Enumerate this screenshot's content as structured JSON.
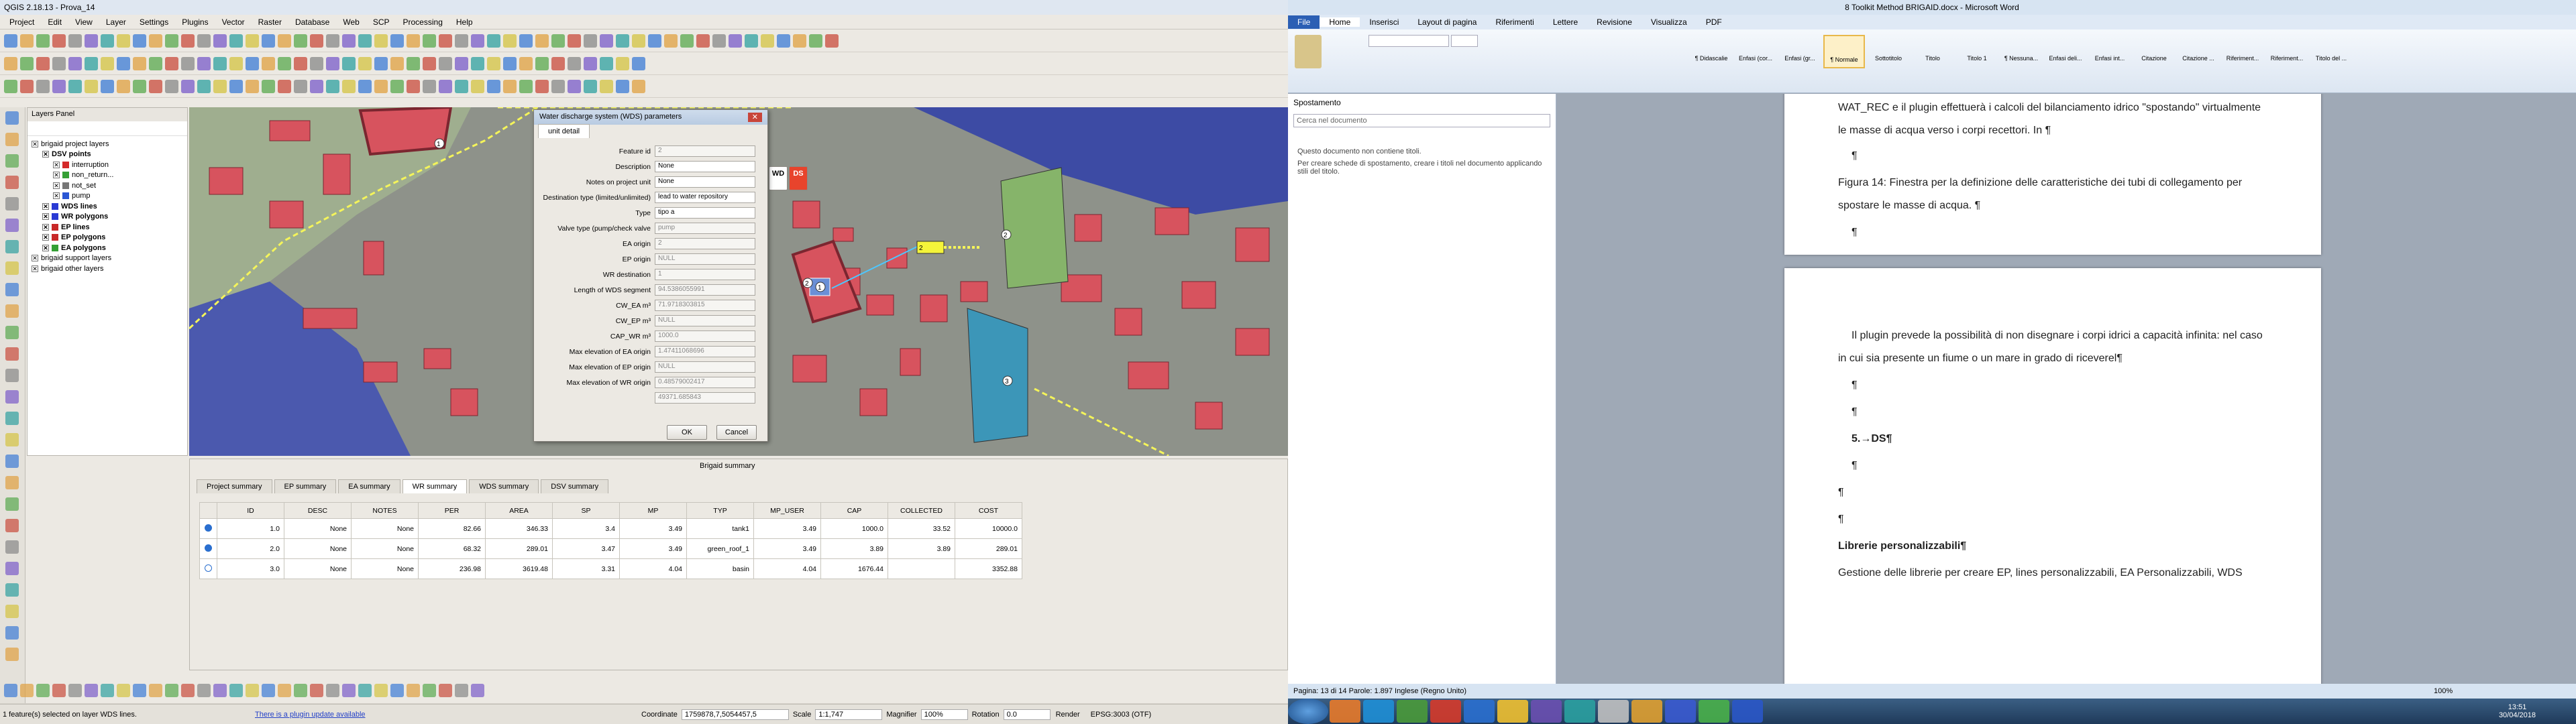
{
  "qgis": {
    "title": "QGIS 2.18.13 - Prova_14",
    "menu": [
      "Project",
      "Edit",
      "View",
      "Layer",
      "Settings",
      "Plugins",
      "Vector",
      "Raster",
      "Database",
      "Web",
      "SCP",
      "Processing",
      "Help"
    ],
    "layers_panel_title": "Layers Panel",
    "layers": [
      "brigaid project layers",
      "DSV points",
      "interruption",
      "non_return...",
      "not_set",
      "pump",
      "WDS lines",
      "WR polygons",
      "EP lines",
      "EP polygons",
      "EA polygons",
      "brigaid support layers",
      "brigaid other layers"
    ],
    "map_labels": [
      "1",
      "2",
      "3",
      "2",
      "1",
      "2"
    ],
    "map_buttons": [
      "WD",
      "DS"
    ],
    "dialog": {
      "title": "Water discharge system (WDS) parameters",
      "tab": "unit detail",
      "fields": [
        {
          "label": "Feature id",
          "value": "2"
        },
        {
          "label": "Description",
          "value": "None"
        },
        {
          "label": "Notes on project unit",
          "value": "None"
        },
        {
          "label": "Destination type (limited/unlimited)",
          "value": "lead to water repository"
        },
        {
          "label": "Type",
          "value": "tipo a"
        },
        {
          "label": "Valve type (pump/check valve",
          "value": "pump"
        },
        {
          "label": "EA origin",
          "value": "2"
        },
        {
          "label": "EP origin",
          "value": "NULL"
        },
        {
          "label": "WR destination",
          "value": "1"
        },
        {
          "label": "Length of WDS segment",
          "value": "94.5386055991"
        },
        {
          "label": "CW_EA m³",
          "value": "71.9718303815"
        },
        {
          "label": "CW_EP m³",
          "value": "NULL"
        },
        {
          "label": "CAP_WR m³",
          "value": "1000.0"
        },
        {
          "label": "Max elevation of EA origin",
          "value": "1.47411068696"
        },
        {
          "label": "Max elevation of EP origin",
          "value": "NULL"
        },
        {
          "label": "Max elevation of WR origin",
          "value": "0.48579002417"
        },
        {
          "label": "",
          "value": "49371.685843"
        }
      ],
      "ok": "OK",
      "cancel": "Cancel"
    },
    "summary": {
      "title": "Brigaid summary",
      "tabs": [
        "Project summary",
        "EP summary",
        "EA summary",
        "WR summary",
        "WDS summary",
        "DSV summary"
      ],
      "columns": [
        "ID",
        "DESC",
        "NOTES",
        "PER",
        "AREA",
        "SP",
        "MP",
        "TYP",
        "MP_USER",
        "CAP",
        "COLLECTED",
        "COST"
      ],
      "rows": [
        [
          "1.0",
          "None",
          "None",
          "82.66",
          "346.33",
          "3.4",
          "3.49",
          "tank1",
          "3.49",
          "1000.0",
          "33.52",
          "10000.0"
        ],
        [
          "2.0",
          "None",
          "None",
          "68.32",
          "289.01",
          "3.47",
          "3.49",
          "green_roof_1",
          "3.49",
          "3.89",
          "3.89",
          "289.01"
        ],
        [
          "3.0",
          "None",
          "None",
          "236.98",
          "3619.48",
          "3.31",
          "4.04",
          "basin",
          "4.04",
          "1676.44",
          "",
          "3352.88"
        ]
      ]
    },
    "status": {
      "left": "1 feature(s) selected on layer WDS lines.",
      "update": "There is a plugin update available",
      "coordinate_label": "Coordinate",
      "coordinate": "1759878,7,5054457,5",
      "scale_label": "Scale",
      "scale": "1:1,747",
      "magnifier_label": "Magnifier",
      "magnifier": "100%",
      "rotation_label": "Rotation",
      "rotation": "0.0",
      "render": "Render",
      "crs": "EPSG:3003 (OTF)"
    }
  },
  "word": {
    "title": "8 Toolkit Method BRIGAID.docx - Microsoft Word",
    "tabs": [
      "File",
      "Home",
      "Inserisci",
      "Layout di pagina",
      "Riferimenti",
      "Lettere",
      "Revisione",
      "Visualizza",
      "PDF"
    ],
    "styles": [
      "¶ Didascalie",
      "Enfasi (cor...",
      "Enfasi (gr...",
      "¶ Normale",
      "Sottotitolo",
      "Titolo",
      "Titolo 1",
      "¶ Nessuna...",
      "Enfasi deli...",
      "Enfasi int...",
      "Citazione",
      "Citazione ...",
      "Riferiment...",
      "Riferiment...",
      "Titolo del ..."
    ],
    "nav_title": "Spostamento",
    "nav_search": "Cerca nel documento",
    "nav_text1": "Questo documento non contiene titoli.",
    "nav_text2": "Per creare schede di spostamento, creare i titoli nel documento applicando stili del titolo.",
    "page1": [
      "WAT_REC e il plugin effettuerà i calcoli del bilanciamento idrico \"spostando\" virtualmente",
      "le masse di acqua verso i corpi recettori. In ¶",
      "¶",
      "Figura 14: Finestra per la definizione delle caratteristiche dei tubi di collegamento per",
      "spostare le masse di acqua. ¶",
      "¶"
    ],
    "page2": [
      "Il plugin prevede la possibilità di non disegnare i corpi idrici a capacità infinita: nel caso",
      "in cui sia presente un fiume o un mare in grado di riceverel¶",
      "¶",
      "¶",
      "5.→DS¶",
      "¶",
      "¶",
      "¶",
      "Librerie personalizzabili¶",
      "Gestione delle librerie per creare EP, lines personalizzabili, EA Personalizzabili, WDS"
    ],
    "status": "Pagina: 13 di 14    Parole: 1.897    Inglese (Regno Unito)",
    "zoom": "100%",
    "clock": "13:51",
    "date": "30/04/2018"
  }
}
